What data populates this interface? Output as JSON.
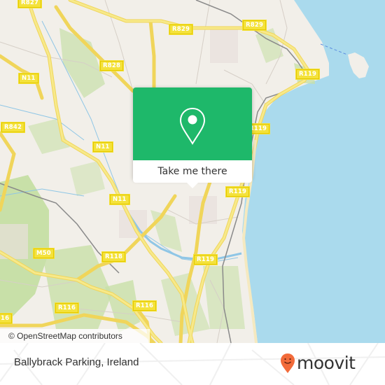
{
  "map": {
    "road_labels": [
      {
        "id": "r827",
        "text": "R827"
      },
      {
        "id": "r829-a",
        "text": "R829"
      },
      {
        "id": "r829-b",
        "text": "R829"
      },
      {
        "id": "r828",
        "text": "R828"
      },
      {
        "id": "n11-a",
        "text": "N11"
      },
      {
        "id": "r842",
        "text": "R842"
      },
      {
        "id": "n11-b",
        "text": "N11"
      },
      {
        "id": "r119-a",
        "text": "R119"
      },
      {
        "id": "r119-b",
        "text": "R119"
      },
      {
        "id": "n11-c",
        "text": "N11"
      },
      {
        "id": "r119-c",
        "text": "R119"
      },
      {
        "id": "r119-d",
        "text": "R119"
      },
      {
        "id": "m50",
        "text": "M50"
      },
      {
        "id": "r118",
        "text": "R118"
      },
      {
        "id": "r116-a",
        "text": "R116"
      },
      {
        "id": "r116-b",
        "text": "R116"
      },
      {
        "id": "r116-c",
        "text": "16"
      }
    ],
    "attribution": "© OpenStreetMap contributors",
    "colors": {
      "land": "#f2efe9",
      "water": "#aadaed",
      "park": "#c8e0a8",
      "major_road": "#f7e36a",
      "popup_green": "#1eb86a"
    }
  },
  "popup": {
    "icon": "map-pin-icon",
    "button_label": "Take me there"
  },
  "footer": {
    "place_name": "Ballybrack Parking, Ireland",
    "brand": "moovit",
    "brand_color": "#f26b3a"
  }
}
